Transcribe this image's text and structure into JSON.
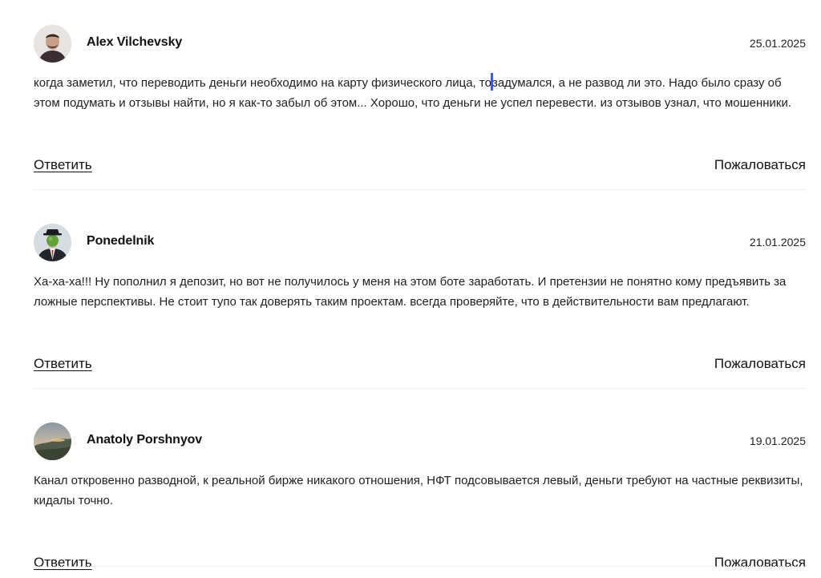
{
  "comments": [
    {
      "author": "Alex Vilchevsky",
      "date": "25.01.2025",
      "text_before_caret": "когда заметил, что переводить деньги необходимо на карту физического лица, то",
      "text_after_caret": "задумался, а не развод ли это. Надо было сразу об этом подумать и отзывы найти, но я как-то забыл об этом... Хорошо, что деньги не успел перевести. из отзывов узнал, что мошенники.",
      "reply_label": "Ответить",
      "report_label": "Пожаловаться",
      "avatar_icon": "user-photo-man"
    },
    {
      "author": "Ponedelnik",
      "date": "21.01.2025",
      "text": "Ха-ха-ха!!! Ну пополнил я депозит, но вот не получилось у меня на этом боте заработать. И претензии не понятно кому предъявить за ложные перспективы. Не стоит тупо так доверять таким проектам. всегда проверяйте, что в действительности вам предлагают.",
      "reply_label": "Ответить",
      "report_label": "Пожаловаться",
      "avatar_icon": "user-photo-green-apple-man"
    },
    {
      "author": "Anatoly Porshnyov",
      "date": "19.01.2025",
      "text": "Канал откровенно разводной, к реальной бирже никакого отношения, НФТ подсовывается левый, деньги требуют на частные реквизиты, кидалы точно.",
      "reply_label": "Ответить",
      "report_label": "Пожаловаться",
      "avatar_icon": "user-photo-landscape"
    }
  ],
  "colors": {
    "text": "#1f1f1f",
    "caret": "#3b63c9",
    "divider": "#dddddd"
  }
}
